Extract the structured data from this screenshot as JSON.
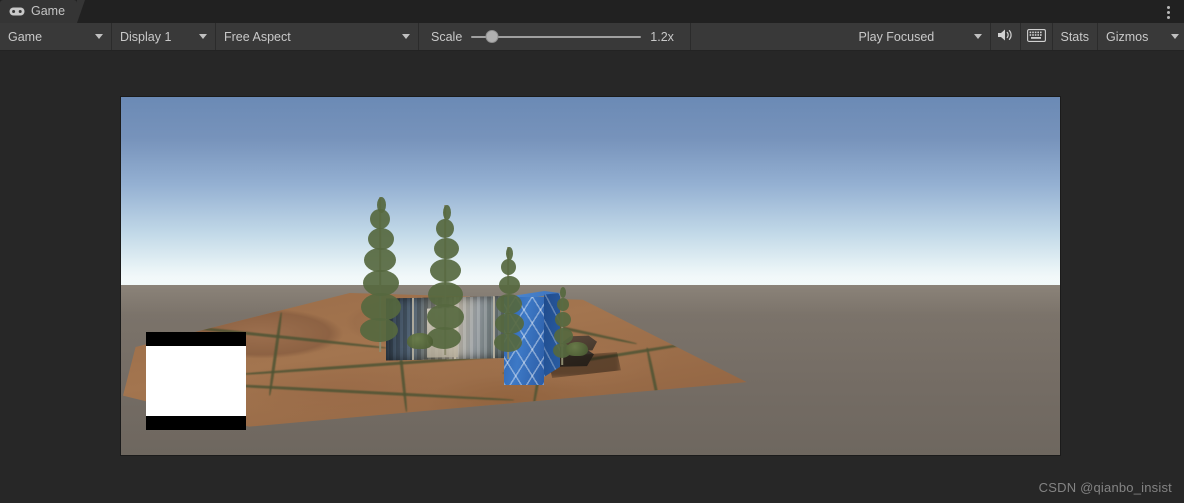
{
  "window": {
    "tab_label": "Game",
    "tab_icon": "gamepad-icon",
    "menu_icon": "kebab-menu-icon"
  },
  "toolbar": {
    "view_mode": "Game",
    "display": "Display 1",
    "aspect": "Free Aspect",
    "scale_label": "Scale",
    "scale_value": "1.2x",
    "scale_percent": 12,
    "play_mode": "Play Focused",
    "mute_audio_icon": "speaker-icon",
    "stats_grid_icon": "keyboard-icon",
    "stats_label": "Stats",
    "gizmos_label": "Gizmos"
  },
  "viewport": {
    "scene_description": "Unity Game view rendering a 3D outdoor scene",
    "sky_top_color": "#6b8ab5",
    "sky_horizon_color": "#fbfdfd",
    "ground_color": "#7a7068",
    "terrain_color": "#9a6c48",
    "pillar_color": "#3d79c6",
    "overlay_fill_color": "#ffffff",
    "overlay_bar_color": "#000000"
  },
  "watermark": {
    "text": "CSDN @qianbo_insist"
  }
}
